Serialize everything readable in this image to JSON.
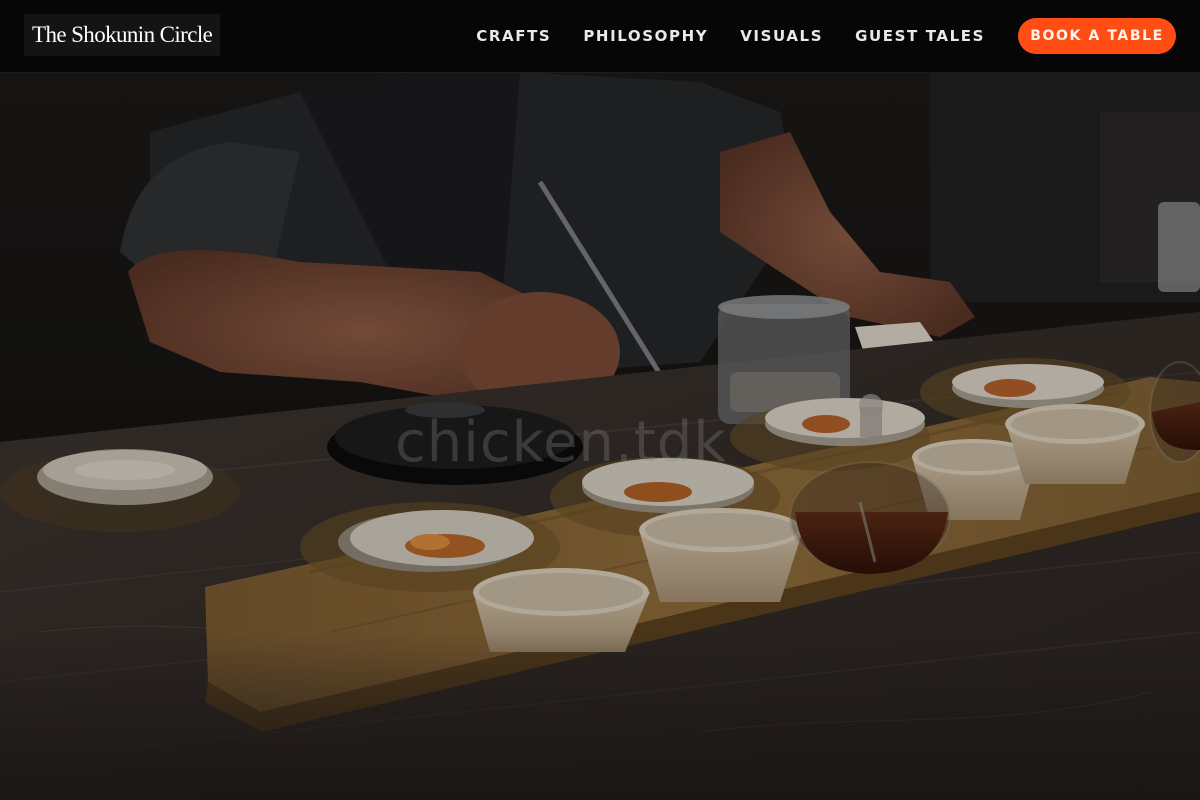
{
  "header": {
    "brand": "The Shokunin Circle",
    "nav": [
      {
        "label": "CRAFTS"
      },
      {
        "label": "PHILOSOPHY"
      },
      {
        "label": "VISUALS"
      },
      {
        "label": "GUEST TALES"
      }
    ],
    "cta_label": "BOOK A TABLE"
  },
  "hero": {
    "watermark": "chicken.tdk"
  },
  "colors": {
    "accent": "#ff4d14",
    "header_bg": "#060606",
    "counter": "#3a332f",
    "tray": "#8a6a3c"
  }
}
